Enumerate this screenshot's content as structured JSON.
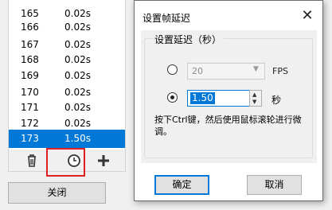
{
  "frames": [
    {
      "num": "165",
      "dur": "0.02s"
    },
    {
      "num": "166",
      "dur": "0.02s"
    },
    {
      "num": "167",
      "dur": "0.02s"
    },
    {
      "num": "168",
      "dur": "0.02s"
    },
    {
      "num": "169",
      "dur": "0.02s"
    },
    {
      "num": "170",
      "dur": "0.02s"
    },
    {
      "num": "171",
      "dur": "0.02s"
    },
    {
      "num": "172",
      "dur": "0.02s"
    },
    {
      "num": "173",
      "dur": "1.50s"
    }
  ],
  "selected_frame": "173",
  "toolbar": {
    "icons": [
      "trash-icon",
      "clock-icon",
      "plus-icon"
    ],
    "highlighted": "clock-icon",
    "highlight_color": "#e02020"
  },
  "close_button": "关闭",
  "dialog": {
    "title": "设置帧延迟",
    "close_glyph": "✕",
    "group_label": "设置延迟（秒）",
    "fps_value": "20",
    "fps_unit": "FPS",
    "delay_value": "1.50",
    "seconds_unit": "秒",
    "hint": "按下Ctrl键，然后使用鼠标滚轮进行微调。",
    "ok_button": "确定",
    "cancel_button": "取消",
    "selected_option": "seconds"
  },
  "colors": {
    "selection": "#0078d7",
    "window_bg": "#f0f0f0"
  }
}
